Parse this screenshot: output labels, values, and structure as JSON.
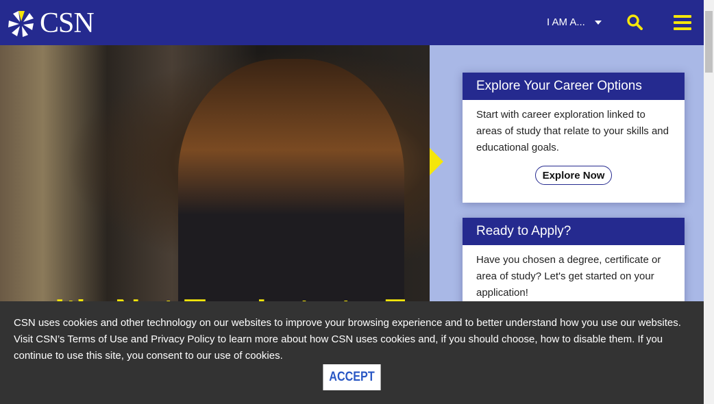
{
  "header": {
    "logo_text": "CSN",
    "iam_label": "I AM A...",
    "colors": {
      "brand": "#252a8f",
      "accent": "#f5e60a"
    }
  },
  "hero": {
    "title": "It's Not Too Late to Enroll"
  },
  "cards": [
    {
      "title": "Explore Your Career Options",
      "body": "Start with career exploration linked to areas of study that relate to your skills and educational goals.",
      "button": "Explore Now"
    },
    {
      "title": "Ready to Apply?",
      "body": "Have you chosen a degree, certificate or area of study? Let's get started on your application!"
    }
  ],
  "cookie": {
    "text": "CSN uses cookies and other technology on our websites to improve your browsing experience and to better understand how you use our websites. Visit CSN’s Terms of Use and Privacy Policy to learn more about how CSN uses cookies and, if you should choose, how to disable them. If you continue to use this site, you consent to our use of cookies.",
    "accept": "ACCEPT"
  }
}
